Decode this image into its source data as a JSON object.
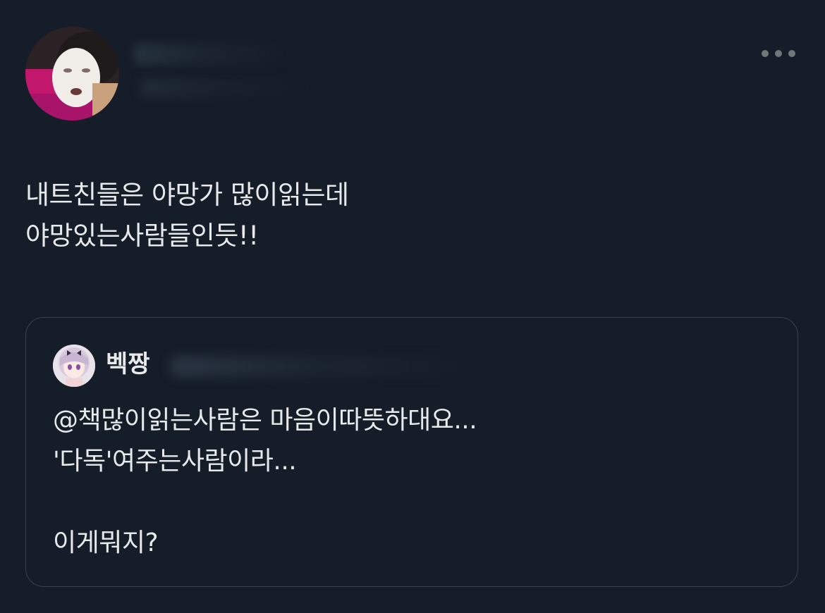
{
  "tweet": {
    "text": "내트친들은 야망가 많이읽는데\n야망있는사람들인듯!!"
  },
  "more_icon": "ellipsis-icon",
  "quote": {
    "author_name": "벡짱",
    "text": "@책많이읽는사람은 마음이따뜻하대요...\n'다독'여주는사람이라...\n\n이게뭐지?"
  },
  "colors": {
    "background": "#151d29",
    "text": "#e7e9ea",
    "muted": "#71767b",
    "border": "#38444d"
  }
}
